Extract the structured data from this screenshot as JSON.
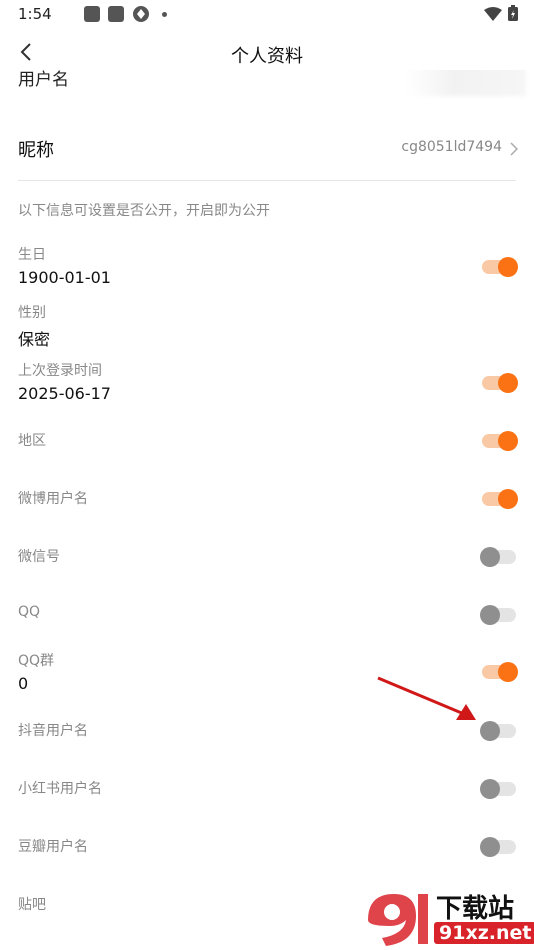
{
  "status_bar": {
    "time": "1:54"
  },
  "header": {
    "title": "个人资料"
  },
  "profile": {
    "username_label": "用户名",
    "nickname_label": "昵称",
    "nickname_value": "cg8051ld7494"
  },
  "privacy_hint": "以下信息可设置是否公开，开启即为公开",
  "fields": [
    {
      "label": "生日",
      "value": "1900-01-01",
      "public": true
    },
    {
      "label": "性别",
      "value": "保密"
    },
    {
      "label": "上次登录时间",
      "value": "2025-06-17",
      "public": true
    },
    {
      "label": "地区",
      "public": true
    },
    {
      "label": "微博用户名",
      "public": true
    },
    {
      "label": "微信号",
      "public": false
    },
    {
      "label": "QQ",
      "public": false
    },
    {
      "label": "QQ群",
      "value": "0",
      "public": true
    },
    {
      "label": "抖音用户名",
      "public": false
    },
    {
      "label": "小红书用户名",
      "public": false
    },
    {
      "label": "豆瓣用户名",
      "public": false
    },
    {
      "label": "贴吧"
    }
  ],
  "watermark": {
    "top_text": "下载站",
    "bottom_text": "91xz.net"
  },
  "colors": {
    "accent": "#fa7214",
    "toggle_on_track": "#f9c8a4",
    "toggle_off_knob": "#8f8f8f"
  }
}
